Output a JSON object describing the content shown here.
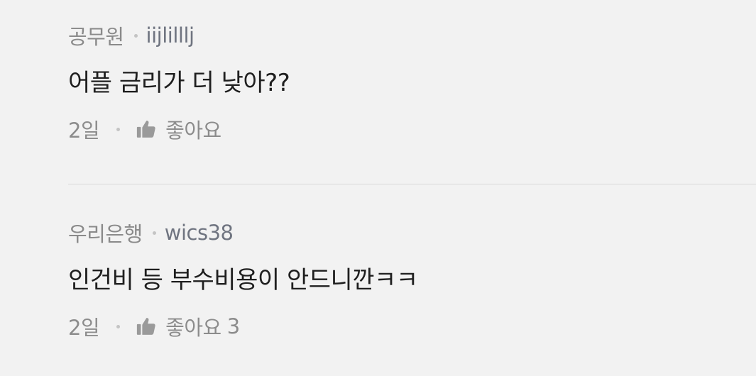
{
  "comments": [
    {
      "affiliation": "공무원",
      "username": "iijlilllj",
      "text": "어플 금리가 더 낮아??",
      "time": "2일",
      "like_label": "좋아요",
      "like_count": ""
    },
    {
      "affiliation": "우리은행",
      "username": "wics38",
      "text": "인건비 등 부수비용이 안드니깐ㅋㅋ",
      "time": "2일",
      "like_label": "좋아요",
      "like_count": "3"
    }
  ],
  "icons": {
    "like": "thumbs-up-icon"
  },
  "colors": {
    "background": "#f2f2f2",
    "body_text": "#1f1f1f",
    "meta_text": "#8a8a8a",
    "divider": "#d9d9d9"
  }
}
